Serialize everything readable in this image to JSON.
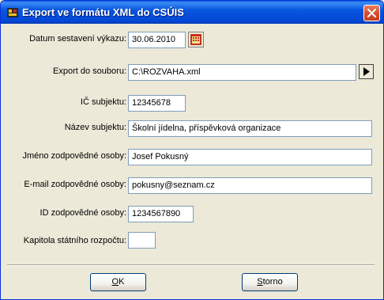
{
  "window": {
    "title": "Export ve formátu XML do CSÚIS"
  },
  "form": {
    "datum_label": "Datum sestavení výkazu:",
    "datum_value": "30.06.2010",
    "export_label": "Export do souboru:",
    "export_value": "C:\\ROZVAHA.xml",
    "ic_label": "IČ subjektu:",
    "ic_value": "12345678",
    "nazev_label": "Název subjektu:",
    "nazev_value": "Školní jídelna, příspěvková organizace",
    "jmeno_label": "Jméno zodpovědné osoby:",
    "jmeno_value": "Josef Pokusný",
    "email_label": "E-mail zodpovědné osoby:",
    "email_value": "pokusny@seznam.cz",
    "id_label": "ID zodpovědné osoby:",
    "id_value": "1234567890",
    "kapitola_label": "Kapitola státního rozpočtu:",
    "kapitola_value": ""
  },
  "buttons": {
    "ok_mnemonic": "O",
    "ok_rest": "K",
    "storno_mnemonic": "S",
    "storno_rest": "torno"
  }
}
